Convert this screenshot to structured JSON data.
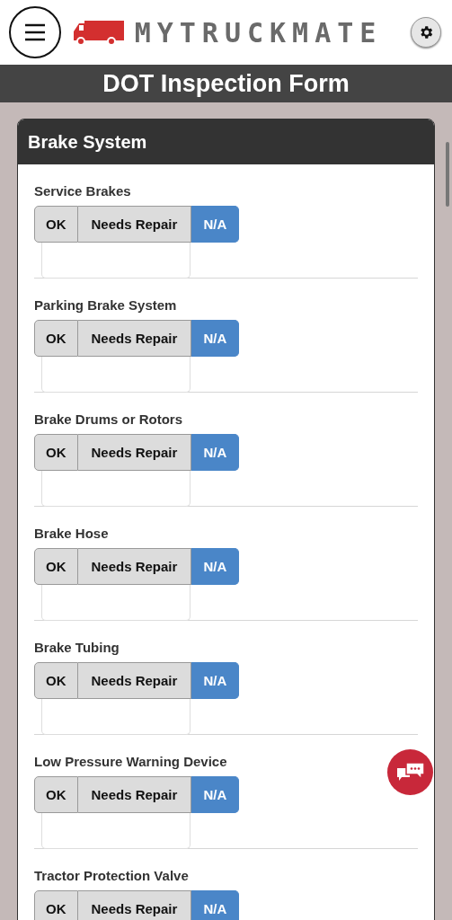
{
  "header": {
    "logo_text": "MYTRUCKMATE"
  },
  "title": "DOT Inspection Form",
  "section": {
    "title": "Brake System",
    "items": [
      {
        "label": "Service Brakes",
        "options": [
          {
            "label": "OK",
            "selected": false
          },
          {
            "label": "Needs Repair",
            "selected": false
          },
          {
            "label": "N/A",
            "selected": true
          }
        ]
      },
      {
        "label": "Parking Brake System",
        "options": [
          {
            "label": "OK",
            "selected": false
          },
          {
            "label": "Needs Repair",
            "selected": false
          },
          {
            "label": "N/A",
            "selected": true
          }
        ]
      },
      {
        "label": "Brake Drums or Rotors",
        "options": [
          {
            "label": "OK",
            "selected": false
          },
          {
            "label": "Needs Repair",
            "selected": false
          },
          {
            "label": "N/A",
            "selected": true
          }
        ]
      },
      {
        "label": "Brake Hose",
        "options": [
          {
            "label": "OK",
            "selected": false
          },
          {
            "label": "Needs Repair",
            "selected": false
          },
          {
            "label": "N/A",
            "selected": true
          }
        ]
      },
      {
        "label": "Brake Tubing",
        "options": [
          {
            "label": "OK",
            "selected": false
          },
          {
            "label": "Needs Repair",
            "selected": false
          },
          {
            "label": "N/A",
            "selected": true
          }
        ]
      },
      {
        "label": "Low Pressure Warning Device",
        "options": [
          {
            "label": "OK",
            "selected": false
          },
          {
            "label": "Needs Repair",
            "selected": false
          },
          {
            "label": "N/A",
            "selected": true
          }
        ]
      },
      {
        "label": "Tractor Protection Valve",
        "options": [
          {
            "label": "OK",
            "selected": false
          },
          {
            "label": "Needs Repair",
            "selected": false
          },
          {
            "label": "N/A",
            "selected": true
          }
        ]
      }
    ]
  }
}
